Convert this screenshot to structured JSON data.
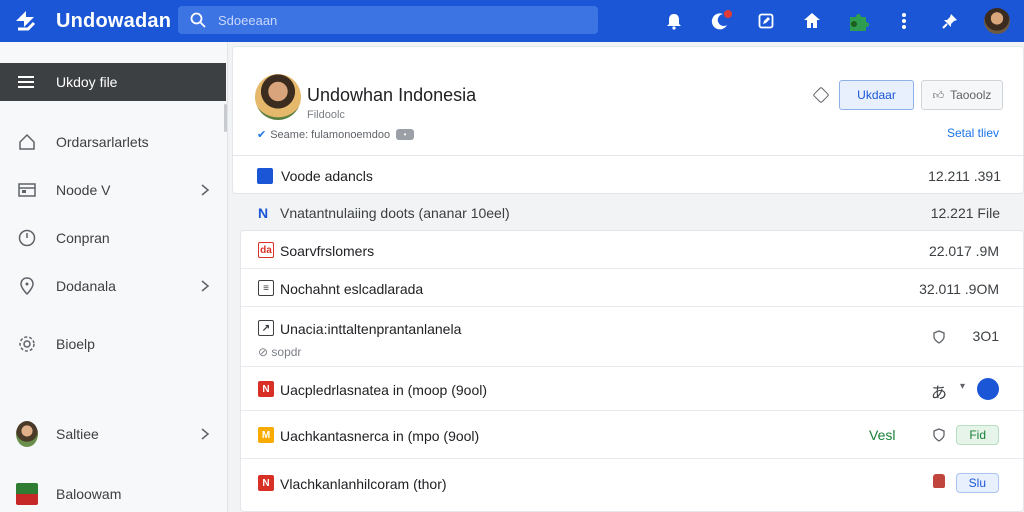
{
  "app": {
    "title": "Undowadan"
  },
  "search": {
    "placeholder": "Sdoeeaan"
  },
  "colors": {
    "topbar": "#1a56d6",
    "accent": "#1a73e8",
    "success": "#188038",
    "danger": "#d93025",
    "warning": "#f9ab00"
  },
  "topbar_icons": [
    "logo-icon",
    "search-icon",
    "bell-icon",
    "moon-icon",
    "edit-icon",
    "home-icon",
    "puzzle-icon",
    "more-vert-icon",
    "pin-icon",
    "avatar"
  ],
  "sidebar": {
    "header_label": "Ukdoy file",
    "items": [
      {
        "label": "Ordarsarlarlets",
        "icon": "home-icon",
        "chevron": false
      },
      {
        "label": "Noode V",
        "icon": "folder-icon",
        "chevron": true
      },
      {
        "label": "Conpran",
        "icon": "clock-icon",
        "chevron": false
      },
      {
        "label": "Dodanala",
        "icon": "location-icon",
        "chevron": true
      },
      {
        "label": "Bioelp",
        "icon": "settings-icon",
        "chevron": false
      },
      {
        "label": "Saltiee",
        "icon": "user-avatar",
        "chevron": true
      },
      {
        "label": "Baloowam",
        "icon": "flag-avatar",
        "chevron": false
      }
    ]
  },
  "profile": {
    "name": "Undowhan Indonesia",
    "subtitle": "Fildoolc",
    "verified_text": "Seame: fulamonoemdoo",
    "primary_button": "Ukdaar",
    "secondary_button": "Taooolz",
    "link": "Setal tliev"
  },
  "main_row": {
    "label": "Voode adancls",
    "value": "12.211 .391"
  },
  "summary_row": {
    "label": "Vnatantnulaiing doots (ananar 10eel)",
    "value": "12.221 File"
  },
  "list": [
    {
      "label": "Soarvfrslomers",
      "value": "22.017 .9M",
      "icon": "file-red-icon"
    },
    {
      "label": "Nochahnt eslcadlarada",
      "value": "32.011 .9OM",
      "icon": "doc-icon"
    },
    {
      "label": "Unacia:inttaltenprantanlanela",
      "sub": "sopdr",
      "value": "3O1",
      "icon": "link-icon"
    },
    {
      "label": "Uacpledrlasnatea in (moop (9ool)",
      "icon": "file-red-icon"
    },
    {
      "label": "Uachkantasnerca in (mpo (9ool)",
      "status": "Vesl",
      "pill": "Fid",
      "icon": "file-yellow-icon"
    },
    {
      "label": "Vlachkanlanhilcoram (thor)",
      "pill": "Slu",
      "icon": "file-red-icon"
    }
  ]
}
